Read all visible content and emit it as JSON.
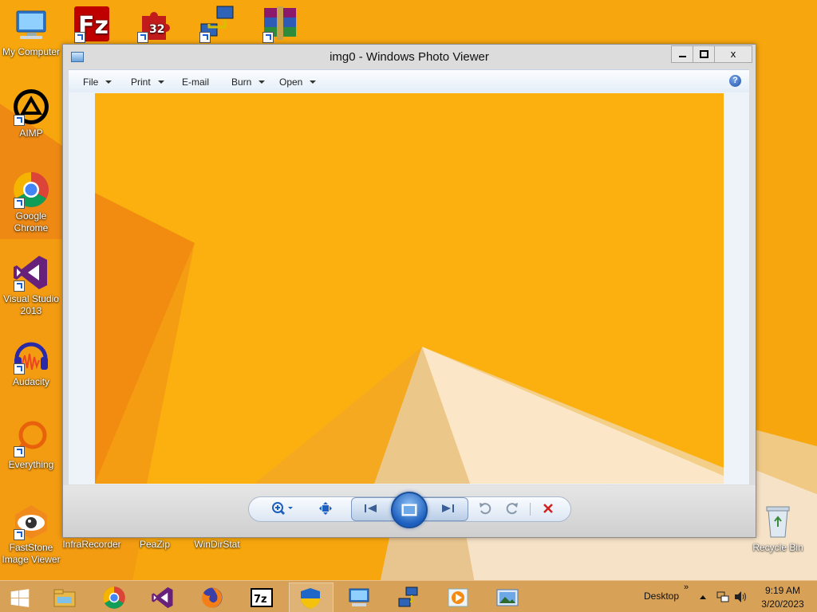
{
  "desktop": {
    "icons": [
      {
        "label": "My Computer",
        "icon": "computer-icon"
      },
      {
        "label": "",
        "icon": "filezilla-icon"
      },
      {
        "label": "",
        "icon": "puzzle-32-icon"
      },
      {
        "label": "",
        "icon": "network-computers-icon"
      },
      {
        "label": "",
        "icon": "winrar-icon"
      },
      {
        "label": "AIMP",
        "icon": "aimp-icon"
      },
      {
        "label": "Google Chrome",
        "icon": "chrome-icon"
      },
      {
        "label": "Visual Studio 2013",
        "icon": "visual-studio-icon"
      },
      {
        "label": "Audacity",
        "icon": "audacity-icon"
      },
      {
        "label": "Everything",
        "icon": "everything-icon"
      },
      {
        "label": "FastStone Image Viewer",
        "icon": "faststone-icon"
      },
      {
        "label": "InfraRecorder",
        "icon": "infrarecorder-icon"
      },
      {
        "label": "PeaZip",
        "icon": "peazip-icon"
      },
      {
        "label": "WinDirStat",
        "icon": "windirstat-icon"
      },
      {
        "label": "Recycle Bin",
        "icon": "recycle-bin-icon"
      }
    ]
  },
  "window": {
    "title": "img0 - Windows Photo Viewer",
    "close_label": "x",
    "menu": [
      "File",
      "Print",
      "E-mail",
      "Burn",
      "Open"
    ],
    "help_label": "?",
    "controls": [
      "zoom-icon",
      "fit-to-window-icon",
      "previous-icon",
      "slideshow-icon",
      "next-icon",
      "rotate-counterclockwise-icon",
      "rotate-clockwise-icon",
      "delete-icon"
    ],
    "colors": {
      "accent": "#1d5fbf",
      "delete": "#d02020"
    }
  },
  "taskbar": {
    "items": [
      "start-icon",
      "file-explorer-icon",
      "chrome-icon",
      "visual-studio-icon",
      "firefox-icon",
      "7zip-icon",
      "shield-icon",
      "computer-icon",
      "network-icon",
      "media-player-icon",
      "photo-viewer-icon"
    ],
    "active_item": "shield-icon",
    "tray_label": "Desktop",
    "tray_chevron": "»",
    "time": "9:19 AM",
    "date": "3/20/2023"
  }
}
